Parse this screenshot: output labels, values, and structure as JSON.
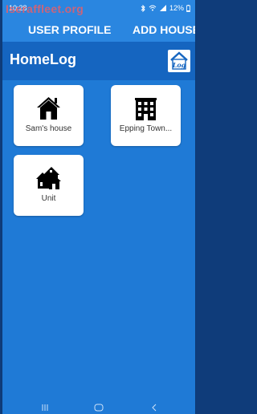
{
  "statusbar": {
    "time": "10:28",
    "battery": "12%",
    "watermark": "Iseraffleet.org"
  },
  "tabs": [
    {
      "label": "USER PROFILE"
    },
    {
      "label": "ADD HOUSE"
    }
  ],
  "app": {
    "title": "HomeLog",
    "logo_text": "LOG"
  },
  "houses": [
    {
      "label": "Sam's house",
      "icon": "house-icon"
    },
    {
      "label": "Epping Town...",
      "icon": "building-icon"
    },
    {
      "label": "Unit",
      "icon": "houses-icon"
    }
  ],
  "colors": {
    "background": "#1f7ad6",
    "appbar": "#1565c0",
    "tabbar": "#2a86e0",
    "card": "#ffffff"
  }
}
